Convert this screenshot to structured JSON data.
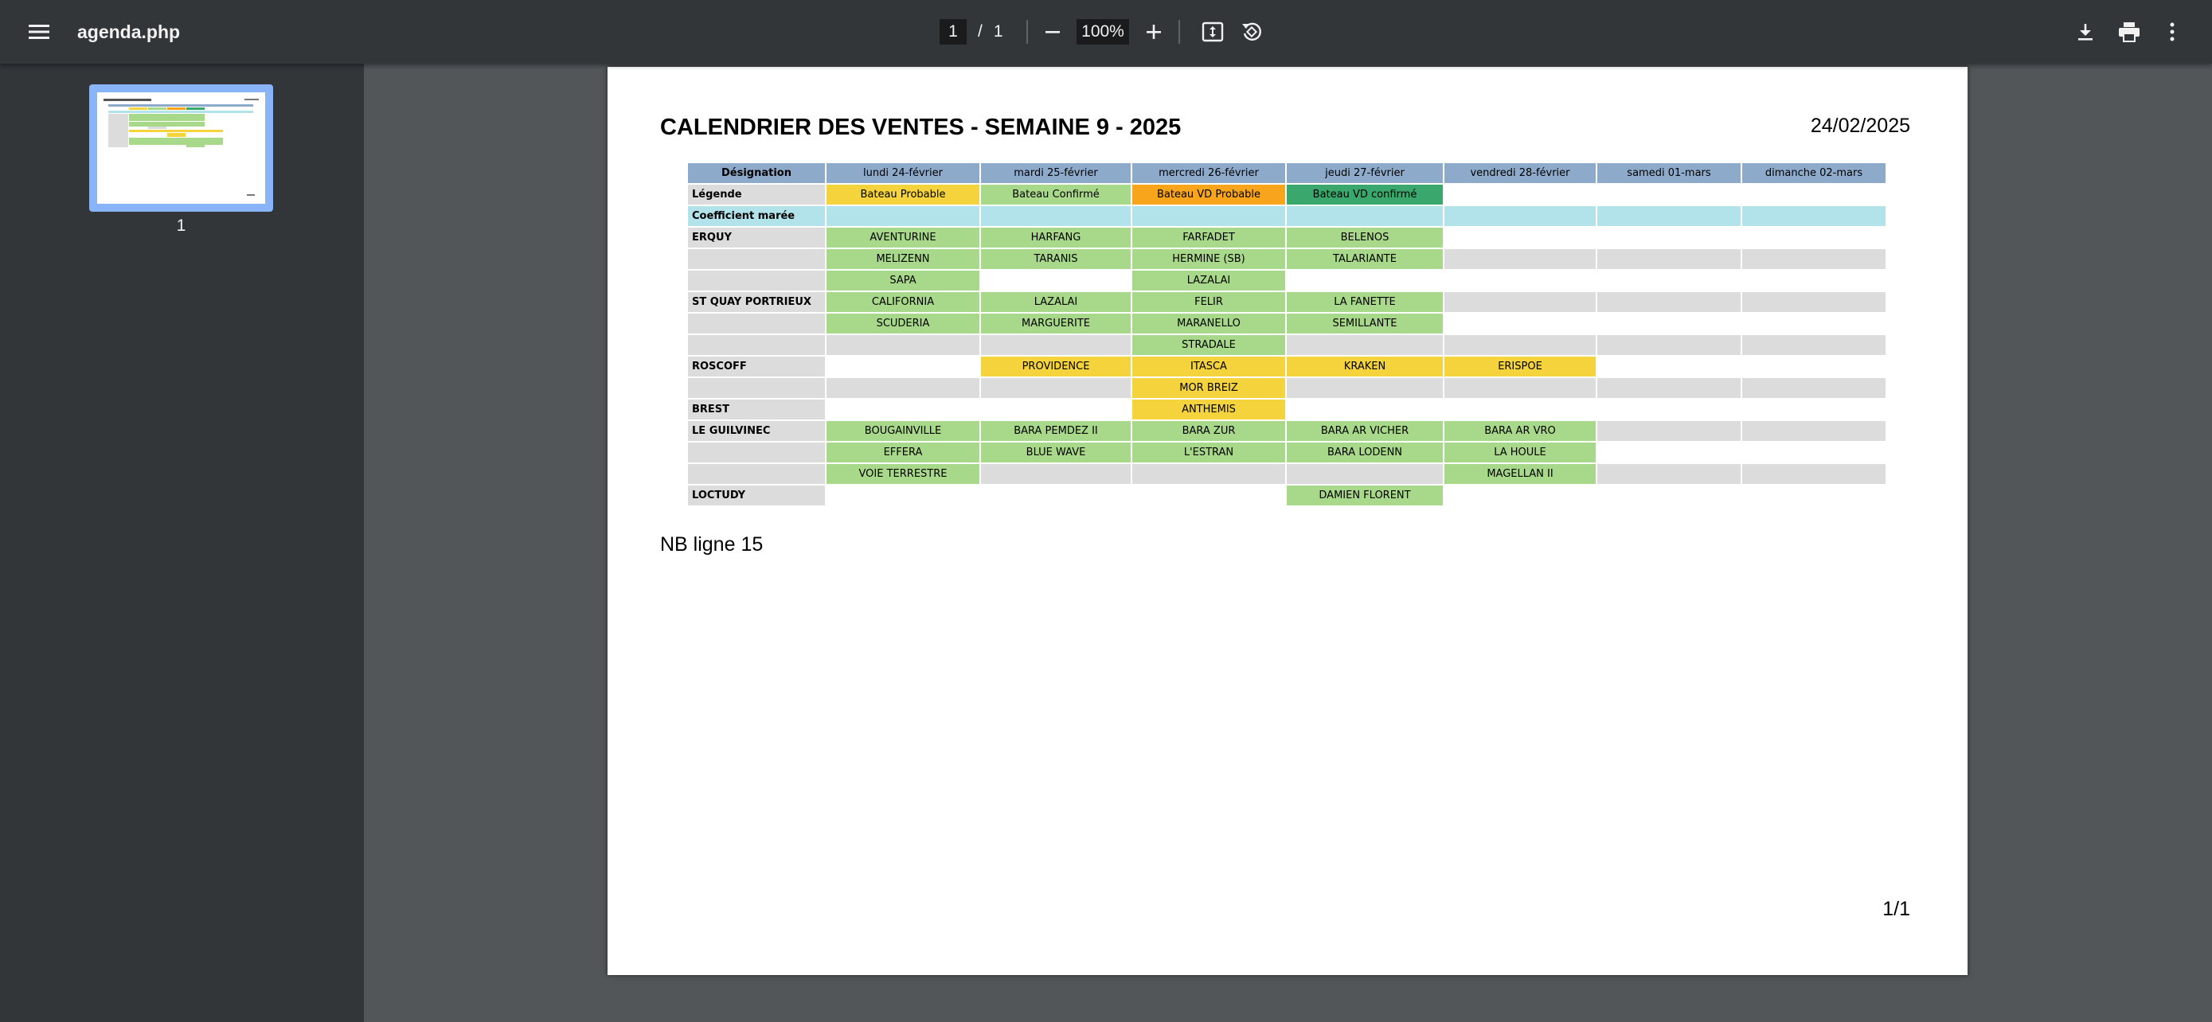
{
  "viewer": {
    "menu_icon": "hamburger-menu-icon",
    "title": "agenda.php",
    "current_page": "1",
    "page_separator": "/",
    "total_pages": "1",
    "zoom": "100%",
    "zoom_out_icon": "minus-icon",
    "zoom_in_icon": "plus-icon",
    "fit_icon": "fit-to-page-icon",
    "rotate_icon": "rotate-icon",
    "download_icon": "download-icon",
    "print_icon": "print-icon",
    "more_icon": "more-vertical-icon"
  },
  "sidebar": {
    "thumbnail_label": "1"
  },
  "document": {
    "title": "CALENDRIER DES VENTES - SEMAINE 9 - 2025",
    "date": "24/02/2025",
    "note": "NB ligne 15",
    "footer": "1/1",
    "colors": {
      "e": "#ffffff",
      "g": "#dcdcdc",
      "v": "#a8d88a",
      "y": "#f5d33c",
      "o": "#f8a51b",
      "t": "#3aa86c",
      "c": "#b2e3ea",
      "header": "#8eaacb"
    },
    "table": {
      "headers": [
        "Désignation",
        "lundi 24-février",
        "mardi 25-février",
        "mercredi 26-février",
        "jeudi 27-février",
        "vendredi 28-février",
        "samedi 01-mars",
        "dimanche 02-mars"
      ],
      "rows": [
        {
          "label": "Légende",
          "cells": [
            {
              "t": "Bateau Probable",
              "c": "y"
            },
            {
              "t": "Bateau Confirmé",
              "c": "v"
            },
            {
              "t": "Bateau VD Probable",
              "c": "o"
            },
            {
              "t": "Bateau VD confirmé",
              "c": "t"
            },
            {
              "t": "",
              "c": "e"
            },
            {
              "t": "",
              "c": "e"
            },
            {
              "t": "",
              "c": "e"
            }
          ]
        },
        {
          "label": "Coefficient marée",
          "label_class": "coef",
          "cells": [
            {
              "t": "",
              "c": "c"
            },
            {
              "t": "",
              "c": "c"
            },
            {
              "t": "",
              "c": "c"
            },
            {
              "t": "",
              "c": "c"
            },
            {
              "t": "",
              "c": "c"
            },
            {
              "t": "",
              "c": "c"
            },
            {
              "t": "",
              "c": "c"
            }
          ]
        },
        {
          "label": "ERQUY",
          "cells": [
            {
              "t": "AVENTURINE",
              "c": "v"
            },
            {
              "t": "HARFANG",
              "c": "v"
            },
            {
              "t": "FARFADET",
              "c": "v"
            },
            {
              "t": "BELENOS",
              "c": "v"
            },
            {
              "t": "",
              "c": "e"
            },
            {
              "t": "",
              "c": "e"
            },
            {
              "t": "",
              "c": "e"
            }
          ]
        },
        {
          "label": "",
          "cells": [
            {
              "t": "MELIZENN",
              "c": "v"
            },
            {
              "t": "TARANIS",
              "c": "v"
            },
            {
              "t": "HERMINE (SB)",
              "c": "v"
            },
            {
              "t": "TALARIANTE",
              "c": "v"
            },
            {
              "t": "",
              "c": "g"
            },
            {
              "t": "",
              "c": "g"
            },
            {
              "t": "",
              "c": "g"
            }
          ]
        },
        {
          "label": "",
          "cells": [
            {
              "t": "SAPA",
              "c": "v"
            },
            {
              "t": "",
              "c": "e"
            },
            {
              "t": "LAZALAI",
              "c": "v"
            },
            {
              "t": "",
              "c": "e"
            },
            {
              "t": "",
              "c": "e"
            },
            {
              "t": "",
              "c": "e"
            },
            {
              "t": "",
              "c": "e"
            }
          ]
        },
        {
          "label": "ST QUAY PORTRIEUX",
          "cells": [
            {
              "t": "CALIFORNIA",
              "c": "v"
            },
            {
              "t": "LAZALAI",
              "c": "v"
            },
            {
              "t": "FELIR",
              "c": "v"
            },
            {
              "t": "LA FANETTE",
              "c": "v"
            },
            {
              "t": "",
              "c": "g"
            },
            {
              "t": "",
              "c": "g"
            },
            {
              "t": "",
              "c": "g"
            }
          ]
        },
        {
          "label": "",
          "cells": [
            {
              "t": "SCUDERIA",
              "c": "v"
            },
            {
              "t": "MARGUERITE",
              "c": "v"
            },
            {
              "t": "MARANELLO",
              "c": "v"
            },
            {
              "t": "SEMILLANTE",
              "c": "v"
            },
            {
              "t": "",
              "c": "e"
            },
            {
              "t": "",
              "c": "e"
            },
            {
              "t": "",
              "c": "e"
            }
          ]
        },
        {
          "label": "",
          "cells": [
            {
              "t": "",
              "c": "g"
            },
            {
              "t": "",
              "c": "g"
            },
            {
              "t": "STRADALE",
              "c": "v"
            },
            {
              "t": "",
              "c": "g"
            },
            {
              "t": "",
              "c": "g"
            },
            {
              "t": "",
              "c": "g"
            },
            {
              "t": "",
              "c": "g"
            }
          ]
        },
        {
          "label": "ROSCOFF",
          "cells": [
            {
              "t": "",
              "c": "e"
            },
            {
              "t": "PROVIDENCE",
              "c": "y"
            },
            {
              "t": "ITASCA",
              "c": "y"
            },
            {
              "t": "KRAKEN",
              "c": "y"
            },
            {
              "t": "ERISPOE",
              "c": "y"
            },
            {
              "t": "",
              "c": "e"
            },
            {
              "t": "",
              "c": "e"
            }
          ]
        },
        {
          "label": "",
          "cells": [
            {
              "t": "",
              "c": "g"
            },
            {
              "t": "",
              "c": "g"
            },
            {
              "t": "MOR BREIZ",
              "c": "y"
            },
            {
              "t": "",
              "c": "g"
            },
            {
              "t": "",
              "c": "g"
            },
            {
              "t": "",
              "c": "g"
            },
            {
              "t": "",
              "c": "g"
            }
          ]
        },
        {
          "label": "BREST",
          "cells": [
            {
              "t": "",
              "c": "e"
            },
            {
              "t": "",
              "c": "e"
            },
            {
              "t": "ANTHEMIS",
              "c": "y"
            },
            {
              "t": "",
              "c": "e"
            },
            {
              "t": "",
              "c": "e"
            },
            {
              "t": "",
              "c": "e"
            },
            {
              "t": "",
              "c": "e"
            }
          ]
        },
        {
          "label": "LE GUILVINEC",
          "cells": [
            {
              "t": "BOUGAINVILLE",
              "c": "v"
            },
            {
              "t": "BARA PEMDEZ II",
              "c": "v"
            },
            {
              "t": "BARA ZUR",
              "c": "v"
            },
            {
              "t": "BARA AR VICHER",
              "c": "v"
            },
            {
              "t": "BARA AR VRO",
              "c": "v"
            },
            {
              "t": "",
              "c": "g"
            },
            {
              "t": "",
              "c": "g"
            }
          ]
        },
        {
          "label": "",
          "cells": [
            {
              "t": "EFFERA",
              "c": "v"
            },
            {
              "t": "BLUE WAVE",
              "c": "v"
            },
            {
              "t": "L'ESTRAN",
              "c": "v"
            },
            {
              "t": "BARA LODENN",
              "c": "v"
            },
            {
              "t": "LA HOULE",
              "c": "v"
            },
            {
              "t": "",
              "c": "e"
            },
            {
              "t": "",
              "c": "e"
            }
          ]
        },
        {
          "label": "",
          "cells": [
            {
              "t": "VOIE TERRESTRE",
              "c": "v"
            },
            {
              "t": "",
              "c": "g"
            },
            {
              "t": "",
              "c": "g"
            },
            {
              "t": "",
              "c": "g"
            },
            {
              "t": "MAGELLAN II",
              "c": "v"
            },
            {
              "t": "",
              "c": "g"
            },
            {
              "t": "",
              "c": "g"
            }
          ]
        },
        {
          "label": "LOCTUDY",
          "cells": [
            {
              "t": "",
              "c": "e"
            },
            {
              "t": "",
              "c": "e"
            },
            {
              "t": "",
              "c": "e"
            },
            {
              "t": "DAMIEN FLORENT",
              "c": "v"
            },
            {
              "t": "",
              "c": "e"
            },
            {
              "t": "",
              "c": "e"
            },
            {
              "t": "",
              "c": "e"
            }
          ]
        }
      ]
    }
  }
}
